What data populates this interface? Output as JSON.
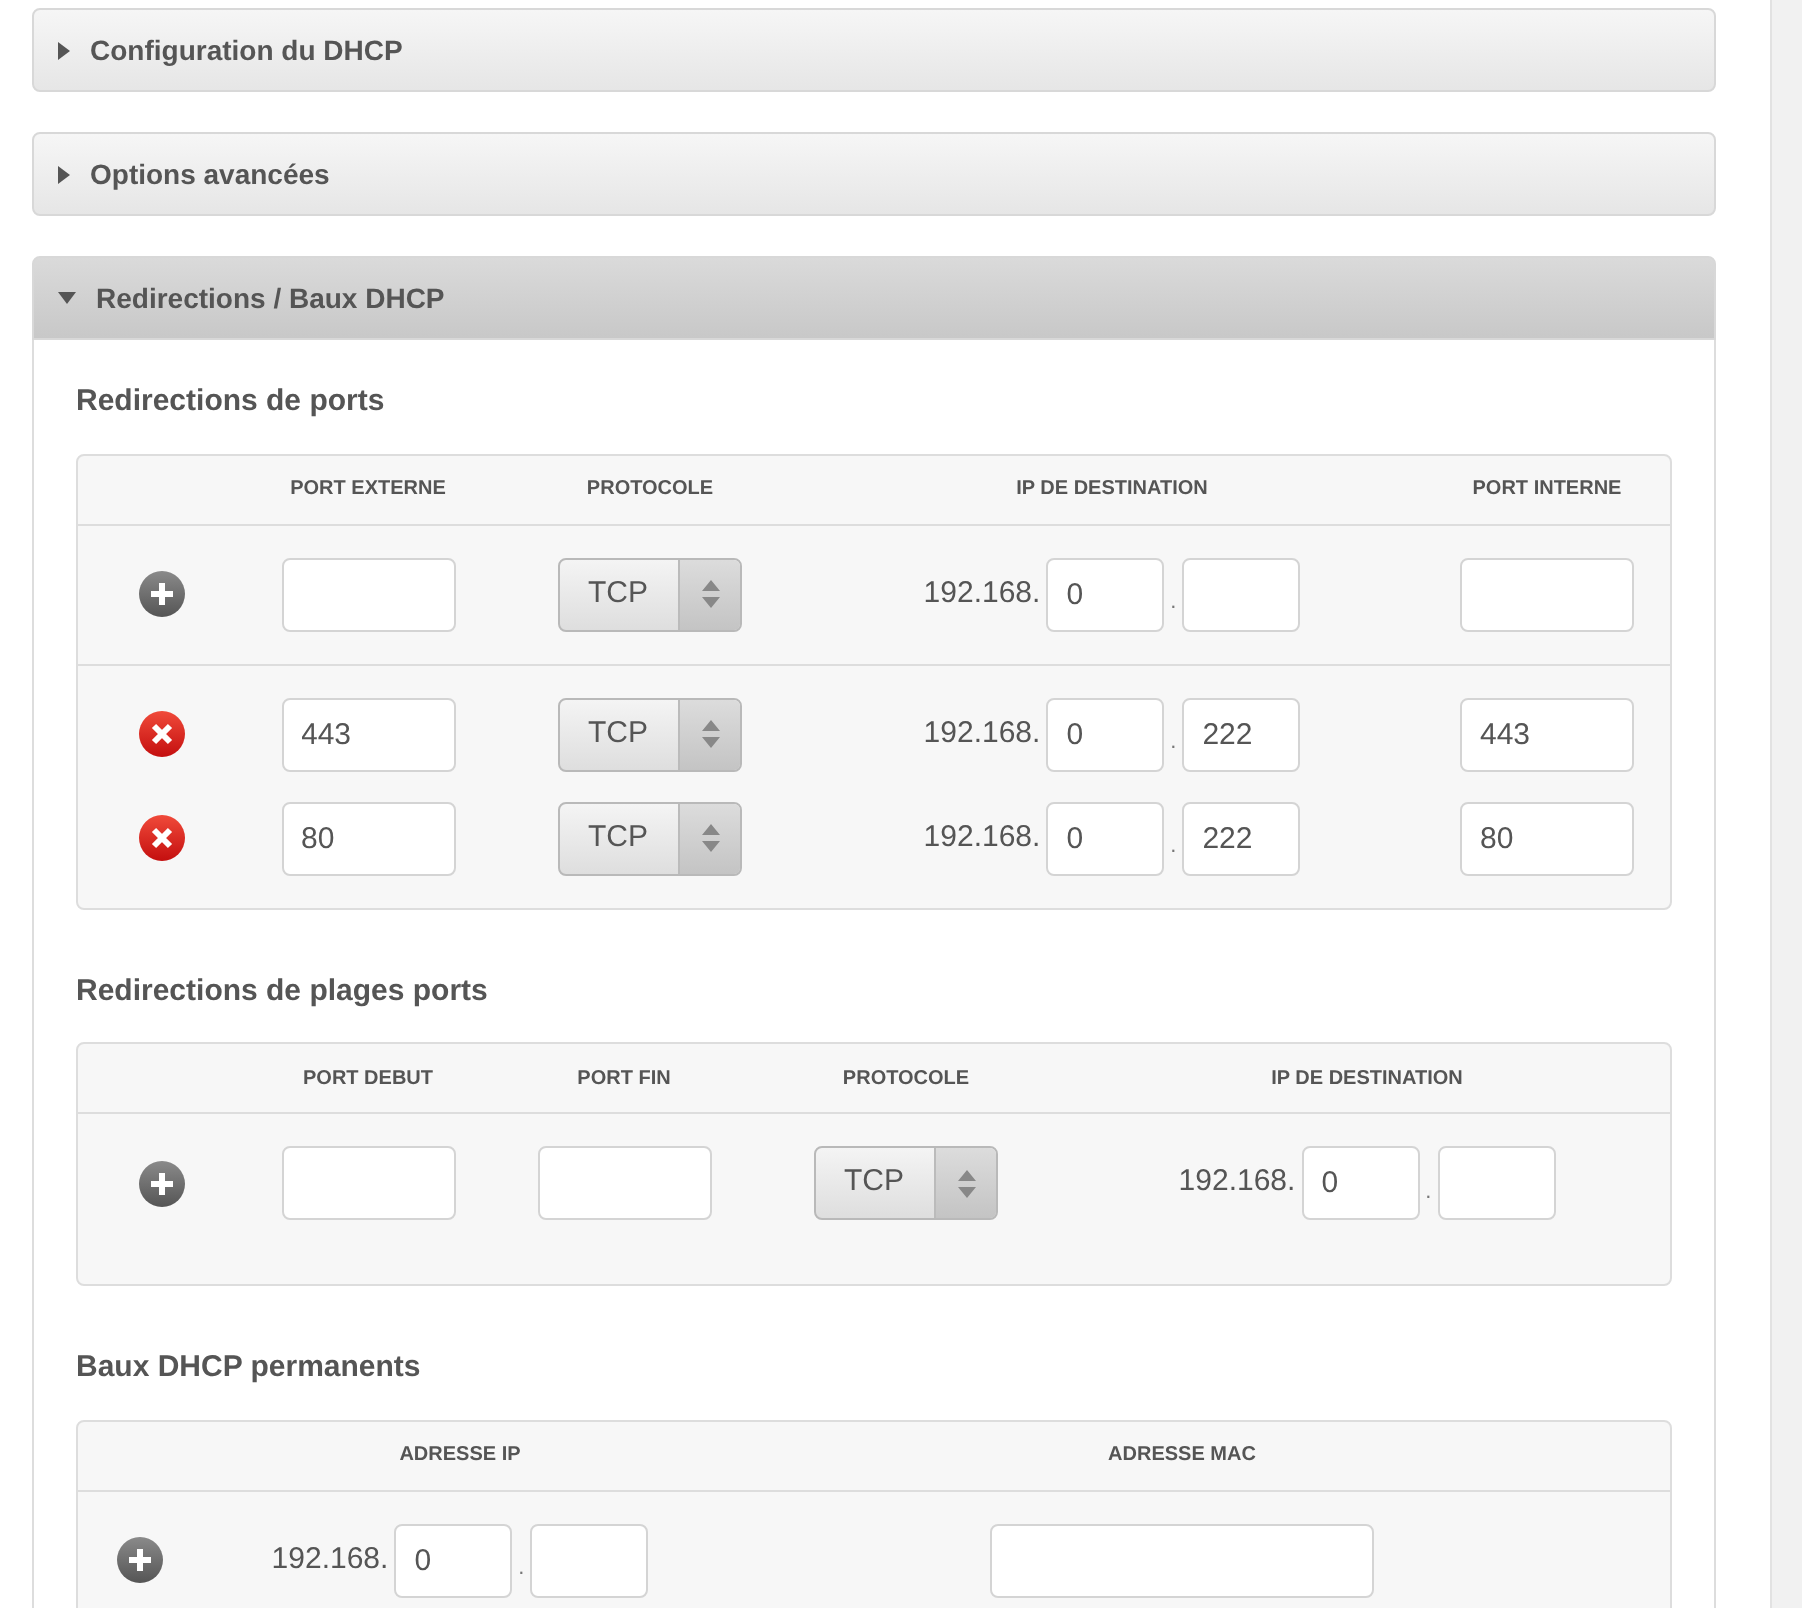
{
  "panels": [
    {
      "title": "Configuration du DHCP",
      "expanded": false
    },
    {
      "title": "Options avancées",
      "expanded": false
    },
    {
      "title": "Redirections / Baux DHCP",
      "expanded": true,
      "sections": [
        {
          "title": "Redirections de ports",
          "kind": "ports",
          "columns": [
            "",
            "PORT EXTERNE",
            "PROTOCOLE",
            "IP DE DESTINATION",
            "PORT INTERNE"
          ],
          "groups": [
            {
              "rows": [
                {
                  "kind": "add",
                  "cells": [
                    {
                      "kind": "input"
                    },
                    {
                      "kind": "select",
                      "value": "TCP"
                    },
                    {
                      "kind": "ip",
                      "prefix": "192.168.",
                      "octet_1": "0",
                      "separator": "."
                    },
                    {
                      "kind": "input"
                    }
                  ]
                }
              ]
            },
            {
              "rows": [
                {
                  "kind": "remove",
                  "cells": [
                    {
                      "kind": "input",
                      "value": "443"
                    },
                    {
                      "kind": "select",
                      "value": "TCP"
                    },
                    {
                      "kind": "ip",
                      "prefix": "192.168.",
                      "octet_1": "0",
                      "octet_2": "222",
                      "separator": "."
                    },
                    {
                      "kind": "input",
                      "value": "443"
                    }
                  ]
                },
                {
                  "kind": "remove",
                  "cells": [
                    {
                      "kind": "input",
                      "value": "80"
                    },
                    {
                      "kind": "select",
                      "value": "TCP"
                    },
                    {
                      "kind": "ip",
                      "prefix": "192.168.",
                      "octet_1": "0",
                      "octet_2": "222",
                      "separator": "."
                    },
                    {
                      "kind": "input",
                      "value": "80"
                    }
                  ]
                }
              ]
            }
          ]
        },
        {
          "title": "Redirections de plages ports",
          "kind": "ranges",
          "columns": [
            "",
            "PORT DEBUT",
            "PORT FIN",
            "PROTOCOLE",
            "IP DE DESTINATION"
          ],
          "groups": [
            {
              "rows": [
                {
                  "kind": "add",
                  "cells": [
                    {
                      "kind": "input"
                    },
                    {
                      "kind": "input"
                    },
                    {
                      "kind": "select",
                      "value": "TCP"
                    },
                    {
                      "kind": "ip",
                      "prefix": "192.168.",
                      "octet_1": "0",
                      "separator": "."
                    }
                  ]
                }
              ]
            }
          ]
        },
        {
          "title": "Baux DHCP permanents",
          "kind": "leases",
          "columns": [
            "",
            "ADRESSE IP",
            "ADRESSE MAC"
          ],
          "groups": [
            {
              "rows": [
                {
                  "kind": "add",
                  "cells": [
                    {
                      "kind": "ip",
                      "prefix": "192.168.",
                      "octet_1": "0",
                      "separator": "."
                    },
                    {
                      "kind": "mac"
                    }
                  ]
                }
              ]
            }
          ]
        }
      ]
    }
  ]
}
